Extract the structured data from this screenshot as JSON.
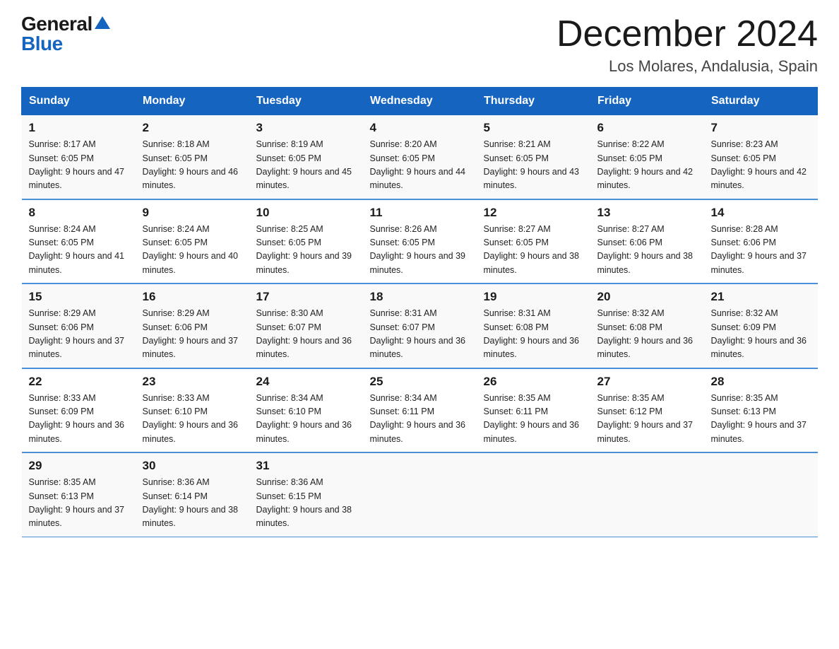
{
  "header": {
    "logo_general": "General",
    "logo_blue": "Blue",
    "month_title": "December 2024",
    "location": "Los Molares, Andalusia, Spain"
  },
  "weekdays": [
    "Sunday",
    "Monday",
    "Tuesday",
    "Wednesday",
    "Thursday",
    "Friday",
    "Saturday"
  ],
  "weeks": [
    [
      {
        "day": "1",
        "sunrise": "Sunrise: 8:17 AM",
        "sunset": "Sunset: 6:05 PM",
        "daylight": "Daylight: 9 hours and 47 minutes."
      },
      {
        "day": "2",
        "sunrise": "Sunrise: 8:18 AM",
        "sunset": "Sunset: 6:05 PM",
        "daylight": "Daylight: 9 hours and 46 minutes."
      },
      {
        "day": "3",
        "sunrise": "Sunrise: 8:19 AM",
        "sunset": "Sunset: 6:05 PM",
        "daylight": "Daylight: 9 hours and 45 minutes."
      },
      {
        "day": "4",
        "sunrise": "Sunrise: 8:20 AM",
        "sunset": "Sunset: 6:05 PM",
        "daylight": "Daylight: 9 hours and 44 minutes."
      },
      {
        "day": "5",
        "sunrise": "Sunrise: 8:21 AM",
        "sunset": "Sunset: 6:05 PM",
        "daylight": "Daylight: 9 hours and 43 minutes."
      },
      {
        "day": "6",
        "sunrise": "Sunrise: 8:22 AM",
        "sunset": "Sunset: 6:05 PM",
        "daylight": "Daylight: 9 hours and 42 minutes."
      },
      {
        "day": "7",
        "sunrise": "Sunrise: 8:23 AM",
        "sunset": "Sunset: 6:05 PM",
        "daylight": "Daylight: 9 hours and 42 minutes."
      }
    ],
    [
      {
        "day": "8",
        "sunrise": "Sunrise: 8:24 AM",
        "sunset": "Sunset: 6:05 PM",
        "daylight": "Daylight: 9 hours and 41 minutes."
      },
      {
        "day": "9",
        "sunrise": "Sunrise: 8:24 AM",
        "sunset": "Sunset: 6:05 PM",
        "daylight": "Daylight: 9 hours and 40 minutes."
      },
      {
        "day": "10",
        "sunrise": "Sunrise: 8:25 AM",
        "sunset": "Sunset: 6:05 PM",
        "daylight": "Daylight: 9 hours and 39 minutes."
      },
      {
        "day": "11",
        "sunrise": "Sunrise: 8:26 AM",
        "sunset": "Sunset: 6:05 PM",
        "daylight": "Daylight: 9 hours and 39 minutes."
      },
      {
        "day": "12",
        "sunrise": "Sunrise: 8:27 AM",
        "sunset": "Sunset: 6:05 PM",
        "daylight": "Daylight: 9 hours and 38 minutes."
      },
      {
        "day": "13",
        "sunrise": "Sunrise: 8:27 AM",
        "sunset": "Sunset: 6:06 PM",
        "daylight": "Daylight: 9 hours and 38 minutes."
      },
      {
        "day": "14",
        "sunrise": "Sunrise: 8:28 AM",
        "sunset": "Sunset: 6:06 PM",
        "daylight": "Daylight: 9 hours and 37 minutes."
      }
    ],
    [
      {
        "day": "15",
        "sunrise": "Sunrise: 8:29 AM",
        "sunset": "Sunset: 6:06 PM",
        "daylight": "Daylight: 9 hours and 37 minutes."
      },
      {
        "day": "16",
        "sunrise": "Sunrise: 8:29 AM",
        "sunset": "Sunset: 6:06 PM",
        "daylight": "Daylight: 9 hours and 37 minutes."
      },
      {
        "day": "17",
        "sunrise": "Sunrise: 8:30 AM",
        "sunset": "Sunset: 6:07 PM",
        "daylight": "Daylight: 9 hours and 36 minutes."
      },
      {
        "day": "18",
        "sunrise": "Sunrise: 8:31 AM",
        "sunset": "Sunset: 6:07 PM",
        "daylight": "Daylight: 9 hours and 36 minutes."
      },
      {
        "day": "19",
        "sunrise": "Sunrise: 8:31 AM",
        "sunset": "Sunset: 6:08 PM",
        "daylight": "Daylight: 9 hours and 36 minutes."
      },
      {
        "day": "20",
        "sunrise": "Sunrise: 8:32 AM",
        "sunset": "Sunset: 6:08 PM",
        "daylight": "Daylight: 9 hours and 36 minutes."
      },
      {
        "day": "21",
        "sunrise": "Sunrise: 8:32 AM",
        "sunset": "Sunset: 6:09 PM",
        "daylight": "Daylight: 9 hours and 36 minutes."
      }
    ],
    [
      {
        "day": "22",
        "sunrise": "Sunrise: 8:33 AM",
        "sunset": "Sunset: 6:09 PM",
        "daylight": "Daylight: 9 hours and 36 minutes."
      },
      {
        "day": "23",
        "sunrise": "Sunrise: 8:33 AM",
        "sunset": "Sunset: 6:10 PM",
        "daylight": "Daylight: 9 hours and 36 minutes."
      },
      {
        "day": "24",
        "sunrise": "Sunrise: 8:34 AM",
        "sunset": "Sunset: 6:10 PM",
        "daylight": "Daylight: 9 hours and 36 minutes."
      },
      {
        "day": "25",
        "sunrise": "Sunrise: 8:34 AM",
        "sunset": "Sunset: 6:11 PM",
        "daylight": "Daylight: 9 hours and 36 minutes."
      },
      {
        "day": "26",
        "sunrise": "Sunrise: 8:35 AM",
        "sunset": "Sunset: 6:11 PM",
        "daylight": "Daylight: 9 hours and 36 minutes."
      },
      {
        "day": "27",
        "sunrise": "Sunrise: 8:35 AM",
        "sunset": "Sunset: 6:12 PM",
        "daylight": "Daylight: 9 hours and 37 minutes."
      },
      {
        "day": "28",
        "sunrise": "Sunrise: 8:35 AM",
        "sunset": "Sunset: 6:13 PM",
        "daylight": "Daylight: 9 hours and 37 minutes."
      }
    ],
    [
      {
        "day": "29",
        "sunrise": "Sunrise: 8:35 AM",
        "sunset": "Sunset: 6:13 PM",
        "daylight": "Daylight: 9 hours and 37 minutes."
      },
      {
        "day": "30",
        "sunrise": "Sunrise: 8:36 AM",
        "sunset": "Sunset: 6:14 PM",
        "daylight": "Daylight: 9 hours and 38 minutes."
      },
      {
        "day": "31",
        "sunrise": "Sunrise: 8:36 AM",
        "sunset": "Sunset: 6:15 PM",
        "daylight": "Daylight: 9 hours and 38 minutes."
      },
      null,
      null,
      null,
      null
    ]
  ]
}
